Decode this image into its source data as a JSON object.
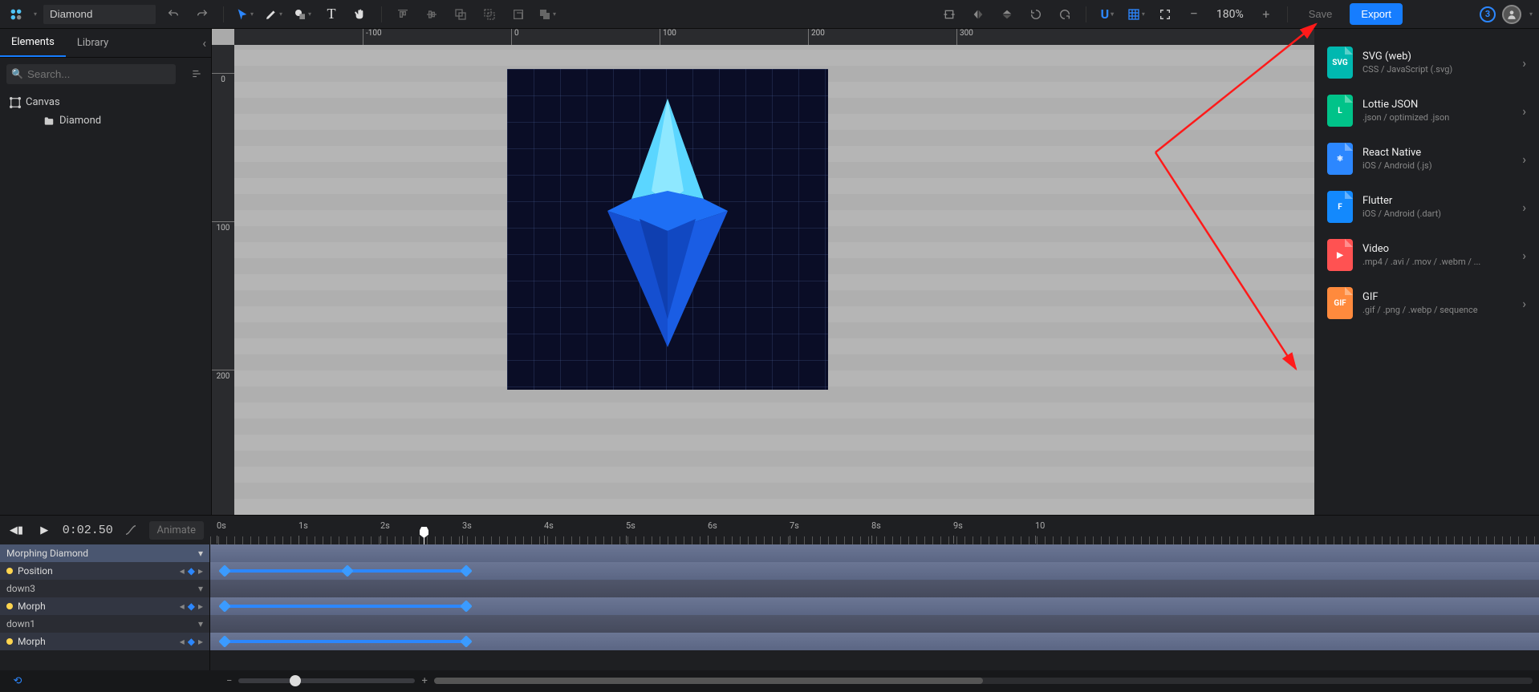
{
  "document_name": "Diamond",
  "zoom_level": "180%",
  "topbar": {
    "save_label": "Save",
    "export_label": "Export",
    "notification_count": "3"
  },
  "left_panel": {
    "tabs": {
      "elements": "Elements",
      "library": "Library"
    },
    "search_placeholder": "Search...",
    "tree": {
      "canvas_label": "Canvas",
      "diamond_label": "Diamond"
    }
  },
  "ruler": {
    "h_ticks": [
      "-100",
      "0",
      "100",
      "200",
      "300"
    ],
    "v_ticks": [
      "0",
      "100",
      "200"
    ]
  },
  "export_panel": [
    {
      "title": "SVG (web)",
      "sub": "CSS / JavaScript (.svg)",
      "color": "#00b8b0",
      "badge": "SVG"
    },
    {
      "title": "Lottie JSON",
      "sub": ".json / optimized .json",
      "color": "#00c389",
      "badge": "L"
    },
    {
      "title": "React Native",
      "sub": "iOS / Android (.js)",
      "color": "#2c87ff",
      "badge": "⚛"
    },
    {
      "title": "Flutter",
      "sub": "iOS / Android (.dart)",
      "color": "#1389fd",
      "badge": "F"
    },
    {
      "title": "Video",
      "sub": ".mp4 / .avi / .mov / .webm / ...",
      "color": "#ff5252",
      "badge": "▶"
    },
    {
      "title": "GIF",
      "sub": ".gif / .png / .webp / sequence",
      "color": "#ff8a3d",
      "badge": "GIF"
    }
  ],
  "timeline": {
    "time_readout": "0:02.50",
    "animate_label": "Animate",
    "header_label": "Morphing Diamond",
    "time_ticks": [
      "0s",
      "1s",
      "2s",
      "3s",
      "4s",
      "5s",
      "6s",
      "7s",
      "8s",
      "9s",
      "10"
    ],
    "tracks": [
      {
        "type": "prop",
        "label": "Position"
      },
      {
        "type": "sub",
        "label": "down3"
      },
      {
        "type": "prop",
        "label": "Morph"
      },
      {
        "type": "sub",
        "label": "down1"
      },
      {
        "type": "prop",
        "label": "Morph"
      }
    ]
  }
}
